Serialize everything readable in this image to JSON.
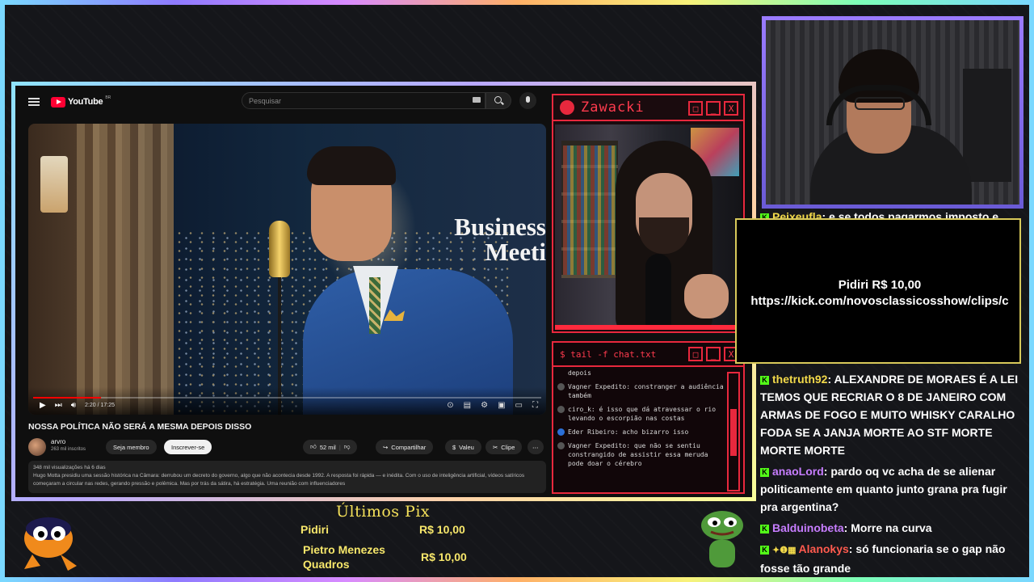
{
  "youtube": {
    "logo_text": "YouTube",
    "logo_region": "BR",
    "search_placeholder": "Pesquisar",
    "video": {
      "overlay_text": "Business Meeti",
      "time_current": "2:20",
      "time_total": "17:25",
      "progress": 0.134
    },
    "title": "NOSSA POLÍTICA NÃO SERÁ A MESMA DEPOIS DISSO",
    "channel": {
      "name": "arvro",
      "subs": "263 mil inscritos"
    },
    "buttons": {
      "member": "Seja membro",
      "subscribe": "Inscrever-se",
      "likes": "52 mil",
      "share": "Compartilhar",
      "thanks": "Valeu",
      "clip": "Clipe"
    },
    "description": {
      "stats": "348 mil visualizações  há 6 dias",
      "text": "Hugo Motta presidiu uma sessão histórica na Câmara: derrubou um decreto do governo, algo que não acontecia desde 1992. A resposta foi rápida — e inédita. Com o uso de inteligência artificial, vídeos satíricos começaram a circular nas redes, gerando pressão e polêmica. Mas por trás da sátira, há estratégia. Uma reunião com influenciadores"
    }
  },
  "zawacki_panel": {
    "title": "Zawacki",
    "btn_max": "□",
    "btn_min": "_",
    "btn_close": "X"
  },
  "terminal": {
    "title": "$ tail -f chat.txt",
    "lines": [
      "depois",
      "Vagner Expedito: constranger a audiência também",
      "ciro_k: é isso que dá atravessar o rio levando o escorpião nas costas",
      "Eder Ribeiro: acho bizarro isso",
      "Vagner Expedito: que não se sentiu constrangido de assistir essa meruda pode doar o cérebro"
    ]
  },
  "alert": {
    "line1": "Pidiri R$ 10,00",
    "line2": "https://kick.com/novosclassicosshow/clips/c"
  },
  "chat": {
    "partial": {
      "user": "Peixeufla",
      "text": ": e se todos pagarmos imposto e"
    },
    "messages": [
      {
        "user": "thetruth92",
        "color": "#f2d94a",
        "text": ": ALEXANDRE DE MORAES É A LEI TEMOS QUE RECRIAR O 8 DE JANEIRO COM ARMAS DE FOGO E MUITO WHISKY CARALHO FODA SE A JANJA MORTE AO STF MORTE MORTE MORTE"
      },
      {
        "user": "anaoLord",
        "color": "#c77dff",
        "text": ": pardo oq vc acha de se alienar politicamente em quanto junto grana pra fugir pra argentina?"
      },
      {
        "user": "Balduinobeta",
        "color": "#c77dff",
        "text": ": Morre na curva"
      },
      {
        "user": "Alanokys",
        "color": "#ff5a4e",
        "text": ": só funcionaria se o gap não fosse tão grande"
      }
    ]
  },
  "pix": {
    "title": "Últimos Pix",
    "rows": [
      {
        "name": "Pidiri",
        "amount": "R$ 10,00"
      },
      {
        "name": "Pietro Menezes Quadros",
        "amount": "R$ 10,00"
      }
    ]
  },
  "colors": {
    "kick_green": "#53fc18",
    "accent_red": "#e8283d",
    "pix_yellow": "#f5e15a"
  }
}
